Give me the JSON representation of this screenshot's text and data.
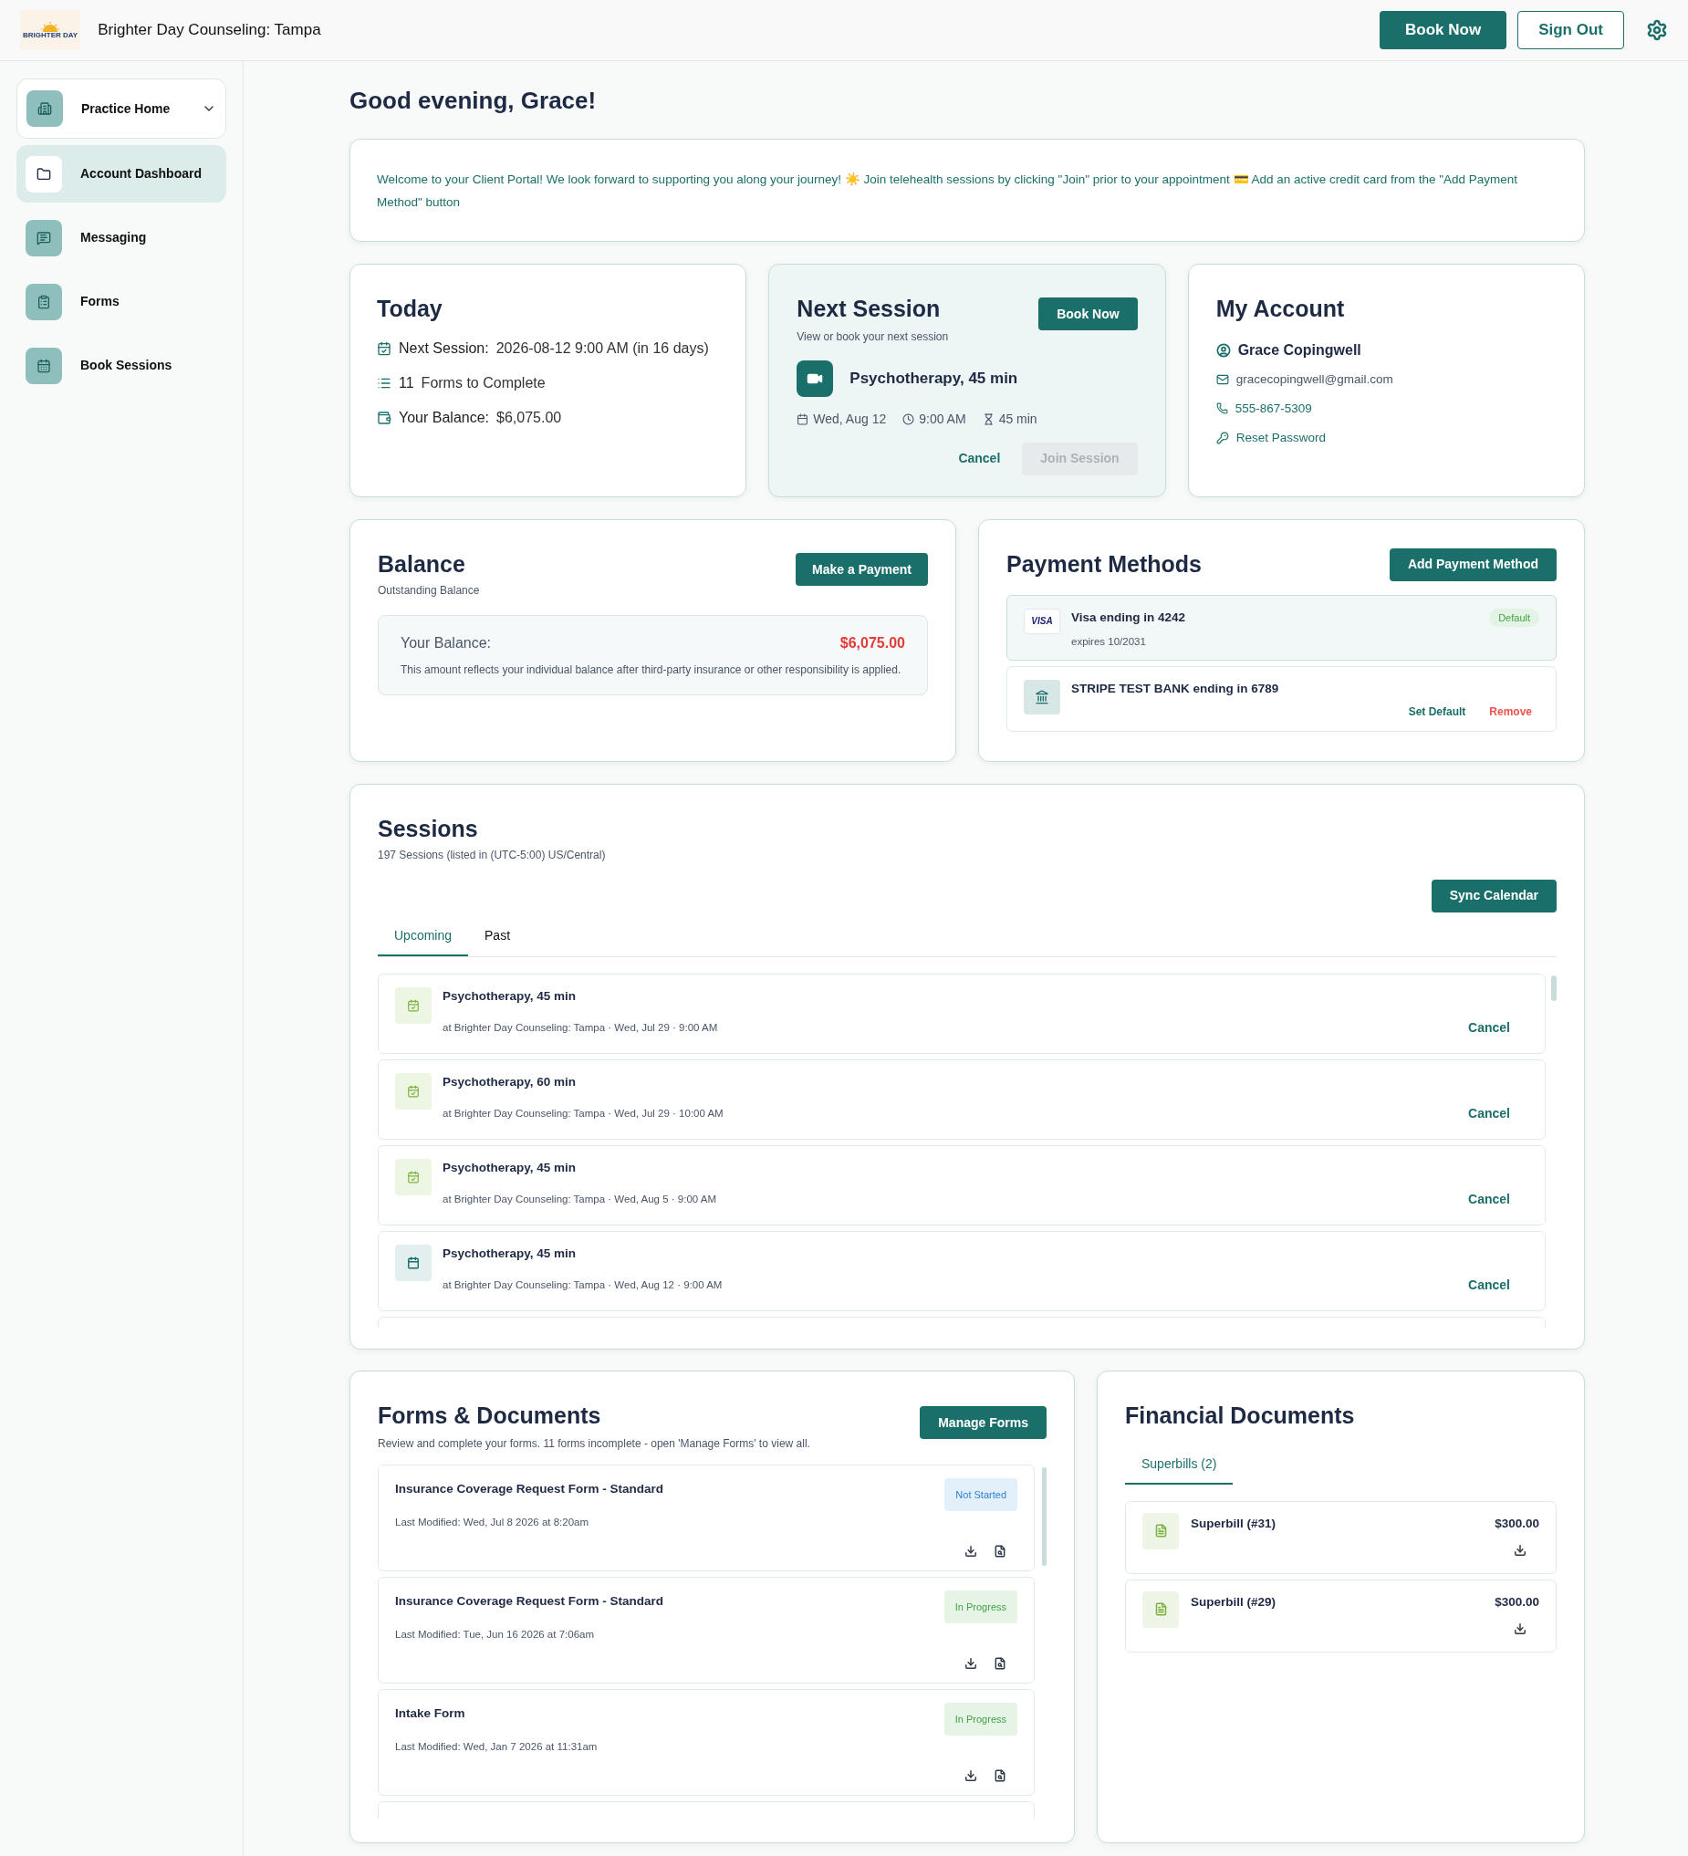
{
  "header": {
    "logo_text": "BRIGHTER DAY",
    "title": "Brighter Day Counseling: Tampa",
    "buttons": [
      {
        "label": "Book Now",
        "kind": "primary"
      },
      {
        "label": "Sign Out",
        "kind": "outline"
      }
    ]
  },
  "sidebar": {
    "items": [
      {
        "label": "Practice Home",
        "kind": "dropdown",
        "selected": false
      },
      {
        "label": "Account Dashboard",
        "kind": "link",
        "selected": true
      },
      {
        "label": "Messaging",
        "kind": "link",
        "selected": false
      },
      {
        "label": "Forms",
        "kind": "link",
        "selected": false
      },
      {
        "label": "Book Sessions",
        "kind": "link",
        "selected": false
      }
    ]
  },
  "greeting": "Good evening, Grace!",
  "welcome": "Welcome to your Client Portal! We look forward to supporting you along your journey! ☀️ Join telehealth sessions by clicking \"Join\" prior to your appointment 💳 Add an active credit card from the \"Add Payment Method\" button",
  "today": {
    "title": "Today",
    "rows": [
      {
        "label": "Next Session:",
        "value": "2026-08-12 9:00 AM (in 16 days)"
      },
      {
        "label": "11",
        "value": "Forms to Complete"
      },
      {
        "label": "Your Balance:",
        "value": "$6,075.00"
      }
    ]
  },
  "next_session": {
    "title": "Next Session",
    "subtitle": "View or book your next session",
    "book_button": "Book Now",
    "session": "Psychotherapy, 45 min",
    "date": "Wed, Aug 12",
    "time": "9:00 AM",
    "duration": "45 min",
    "cancel": "Cancel",
    "join": {
      "label": "Join Session",
      "disabled": true
    }
  },
  "my_account": {
    "title": "My Account",
    "name": "Grace Copingwell",
    "email": "gracecopingwell@gmail.com",
    "phone": "555-867-5309",
    "reset": "Reset Password"
  },
  "balance": {
    "title": "Balance",
    "subtitle": "Outstanding Balance",
    "button": "Make a Payment",
    "label": "Your Balance:",
    "amount": "$6,075.00",
    "note": "This amount reflects your individual balance after third-party insurance or other responsibility is applied."
  },
  "payment_methods": {
    "title": "Payment Methods",
    "button": "Add Payment Method",
    "items": [
      {
        "kind": "card",
        "brand": "VISA",
        "name": "Visa ending in 4242",
        "expires": "expires 10/2031",
        "default": true,
        "badge": "Default"
      },
      {
        "kind": "bank",
        "name": "STRIPE TEST BANK ending in 6789",
        "default": false,
        "actions": [
          "Set Default",
          "Remove"
        ]
      }
    ]
  },
  "sessions": {
    "title": "Sessions",
    "subtitle": "197 Sessions (listed in (UTC-5:00) US/Central)",
    "sync": "Sync Calendar",
    "tabs": [
      {
        "label": "Upcoming",
        "selected": true
      },
      {
        "label": "Past",
        "selected": false
      }
    ],
    "items": [
      {
        "kind": "confirmed",
        "title": "Psychotherapy, 45 min",
        "detail": "at Brighter Day Counseling: Tampa · Wed, Jul 29 · 9:00 AM",
        "action": "Cancel"
      },
      {
        "kind": "confirmed",
        "title": "Psychotherapy, 60 min",
        "detail": "at Brighter Day Counseling: Tampa · Wed, Jul 29 · 10:00 AM",
        "action": "Cancel"
      },
      {
        "kind": "confirmed",
        "title": "Psychotherapy, 45 min",
        "detail": "at Brighter Day Counseling: Tampa · Wed, Aug 5 · 9:00 AM",
        "action": "Cancel"
      },
      {
        "kind": "scheduled",
        "title": "Psychotherapy, 45 min",
        "detail": "at Brighter Day Counseling: Tampa · Wed, Aug 12 · 9:00 AM",
        "action": "Cancel"
      }
    ]
  },
  "forms": {
    "title": "Forms & Documents",
    "subtitle": "Review and complete your forms. 11 forms incomplete - open 'Manage Forms' to view all.",
    "button": "Manage Forms",
    "items": [
      {
        "kind": "not_started",
        "title": "Insurance Coverage Request Form - Standard",
        "modified": "Last Modified: Wed, Jul 8 2026 at 8:20am",
        "status": "Not Started"
      },
      {
        "kind": "in_progress",
        "title": "Insurance Coverage Request Form - Standard",
        "modified": "Last Modified: Tue, Jun 16 2026 at 7:06am",
        "status": "In Progress"
      },
      {
        "kind": "in_progress",
        "title": "Intake Form",
        "modified": "Last Modified: Wed, Jan 7 2026 at 11:31am",
        "status": "In Progress"
      }
    ]
  },
  "financial": {
    "title": "Financial Documents",
    "tabs": [
      {
        "label": "Superbills (2)",
        "selected": true
      }
    ],
    "items": [
      {
        "title": "Superbill (#31)",
        "amount": "$300.00"
      },
      {
        "title": "Superbill (#29)",
        "amount": "$300.00"
      }
    ]
  }
}
